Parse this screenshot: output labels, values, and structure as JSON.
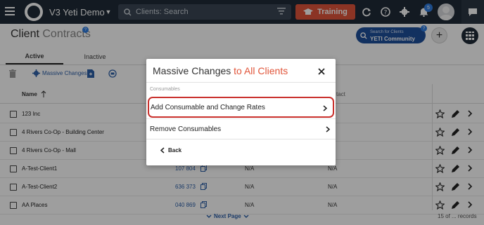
{
  "topbar": {
    "app_title": "V3 Yeti Demo",
    "search_placeholder": "Clients: Search",
    "training_label": "Training",
    "notification_count": "5"
  },
  "page": {
    "title_main": "Client",
    "title_light": "Contracts",
    "help": "?",
    "search_clients_small": "Search for Clients",
    "search_clients_big": "YETI Community",
    "add": "+"
  },
  "tabs": [
    {
      "label": "Active"
    },
    {
      "label": "Inactive"
    }
  ],
  "toolbar": {
    "massive_changes": "Massive Changes"
  },
  "table": {
    "col_name": "Name",
    "col_contact": "tact",
    "rows": [
      {
        "name": "123 Inc",
        "num": "",
        "na1": "",
        "na2": ""
      },
      {
        "name": "4 Rivers Co-Op - Building Center",
        "num": "",
        "na1": "",
        "na2": ""
      },
      {
        "name": "4 Rivers Co-Op - Mall",
        "num": "",
        "na1": "",
        "na2": ""
      },
      {
        "name": "A-Test-Client1",
        "num": "107 804",
        "na1": "N/A",
        "na2": "N/A"
      },
      {
        "name": "A-Test-Client2",
        "num": "636 373",
        "na1": "N/A",
        "na2": "N/A"
      },
      {
        "name": "AA Places",
        "num": "040 869",
        "na1": "N/A",
        "na2": "N/A"
      }
    ]
  },
  "pager": {
    "next_page": "Next Page",
    "records": "15 of ... records"
  },
  "modal": {
    "title_main": "Massive Changes",
    "title_accent": "to All Clients",
    "section_label": "Consumables",
    "options": [
      {
        "label": "Add Consumable and Change Rates"
      },
      {
        "label": "Remove Consumables"
      }
    ],
    "back_label": "Back"
  },
  "colors": {
    "topbar_bg": "#1f2b37",
    "accent_orange": "#e1553a",
    "link_blue": "#2d5fa8",
    "highlight_red": "#c9302c"
  }
}
